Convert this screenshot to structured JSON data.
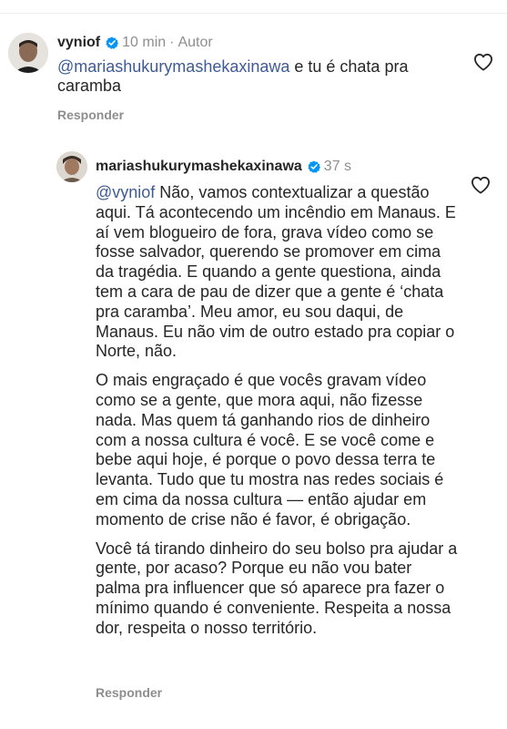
{
  "comments": [
    {
      "username": "vyniof",
      "time": "10 min",
      "separator": "·",
      "author_badge": "Autor",
      "mention": "@mariashukurymashekaxinawa",
      "text": " e tu é chata pra caramba",
      "reply_label": "Responder"
    },
    {
      "username": "mariashukurymashekaxinawa",
      "time": "37 s",
      "mention": "@vyniof",
      "paragraphs": [
        " Não, vamos contextualizar a questão aqui. Tá acontecendo um incêndio em Manaus. E aí vem blogueiro de fora, grava vídeo como se fosse salvador, querendo se promover em cima da tragédia. E quando a gente questiona, ainda tem a cara de pau de dizer que a gente é ‘chata pra caramba’. Meu amor, eu sou daqui, de Manaus. Eu não vim de outro estado pra copiar o Norte, não.",
        "O mais engraçado é que vocês gravam vídeo como se a gente, que mora aqui, não fizesse nada. Mas quem tá ganhando rios de dinheiro com a nossa cultura é você. E se você come e bebe aqui hoje, é porque o povo dessa terra te levanta. Tudo que tu mostra nas redes sociais é em cima da nossa cultura — então ajudar em momento de crise não é favor, é obrigação.",
        "Você tá tirando dinheiro do seu bolso pra ajudar a gente, por acaso? Porque eu não vou bater palma pra influencer que só aparece pra fazer o mínimo quando é conveniente. Respeita a nossa dor, respeita o nosso território."
      ],
      "reply_label": "Responder"
    }
  ],
  "icons": {
    "verified": "verified-badge-icon",
    "like": "heart-outline-icon"
  },
  "colors": {
    "mention": "#3f5b95",
    "verified": "#0095f6",
    "muted": "#8e8e8e"
  }
}
